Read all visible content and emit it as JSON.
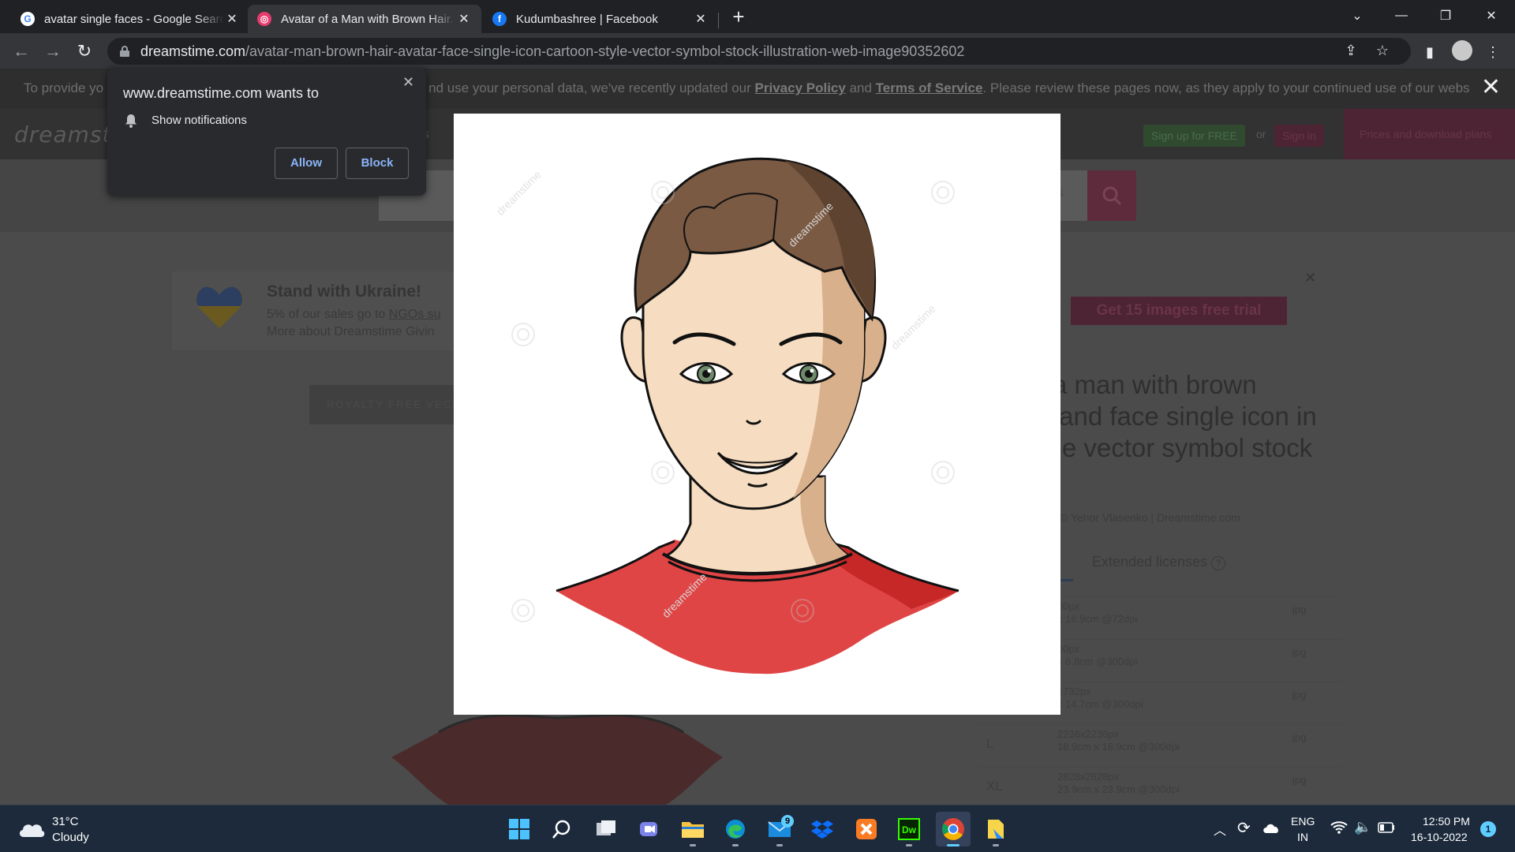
{
  "browser": {
    "tabs": [
      {
        "title": "avatar single faces - Google Search",
        "favicon": "google-icon"
      },
      {
        "title": "Avatar of a Man with Brown Hair. Avatar and Face Single Icon",
        "favicon": "dreamstime-icon"
      },
      {
        "title": "Kudumbashree | Facebook",
        "favicon": "facebook-icon"
      }
    ],
    "active_tab_index": 1,
    "url_host": "dreamstime.com",
    "url_path": "/avatar-man-brown-hair-avatar-face-single-icon-cartoon-style-vector-symbol-stock-illustration-web-image90352602"
  },
  "notification_prompt": {
    "title": "www.dreamstime.com wants to",
    "permission": "Show notifications",
    "allow_label": "Allow",
    "block_label": "Block"
  },
  "page": {
    "cookie_text_1": "To provide yo",
    "cookie_text_2": "nd use your personal data, we've recently updated our ",
    "privacy_link": "Privacy Policy",
    "and_text": " and ",
    "terms_link": "Terms of Service",
    "cookie_text_3": ". Please review these pages now, as they apply to your continued use of our webs",
    "logo": "dreamstim",
    "header_partial": "s",
    "signup_label": "Sign up for FREE",
    "or_label": "or",
    "signin_label": "Sign in",
    "prices_label": "Prices and download plans",
    "search_partial": "s",
    "ukraine_title": "Stand with Ukraine!",
    "ukraine_line1": "5% of our sales go to ",
    "ukraine_link": "NGOs su",
    "ukraine_line2": "More about Dreamstime Givin",
    "royalty_label": "ROYALTY FREE VECTO",
    "promo_label": "Get 15 images free trial",
    "title_lines": [
      "a man with brown",
      "r and face single icon in",
      "yle vector symbol stock",
      "."
    ],
    "credit": "© Yehor Vlasenko | Dreamstime.com",
    "extended_licenses": "Extended licenses",
    "sizes": [
      {
        "size": "",
        "px": "00px",
        "cm": "x 16.9cm @72dpi",
        "format": "jpg"
      },
      {
        "size": "",
        "px": "00px",
        "cm": "x 6.8cm @300dpi",
        "format": "jpg"
      },
      {
        "size": "",
        "px": "1732px",
        "cm": "x 14.7cm @300dpi",
        "format": "jpg"
      },
      {
        "size": "L",
        "px": "2236x2236px",
        "cm": "18.9cm x 18.9cm @300dpi",
        "format": "jpg"
      },
      {
        "size": "XL",
        "px": "2828x2828px",
        "cm": "23.9cm x 23.9cm @300dpi",
        "format": "jpg"
      }
    ],
    "lightbox_watermark": "dreamstime"
  },
  "taskbar": {
    "weather_temp": "31°C",
    "weather_desc": "Cloudy",
    "mail_badge": "9",
    "lang_1": "ENG",
    "lang_2": "IN",
    "time": "12:50 PM",
    "date": "16-10-2022",
    "notification_count": "1",
    "apps": [
      "start-icon",
      "search-icon",
      "task-view-icon",
      "teams-chat-icon",
      "file-explorer-icon",
      "edge-icon",
      "mail-icon",
      "dropbox-icon",
      "xampp-icon",
      "dreamweaver-icon",
      "chrome-icon",
      "notepad-icon"
    ]
  },
  "colors": {
    "shirt": "#e04545",
    "hair": "#7b5a43",
    "skin": "#f6dcc0",
    "accent_blue": "#8ab4f8"
  }
}
